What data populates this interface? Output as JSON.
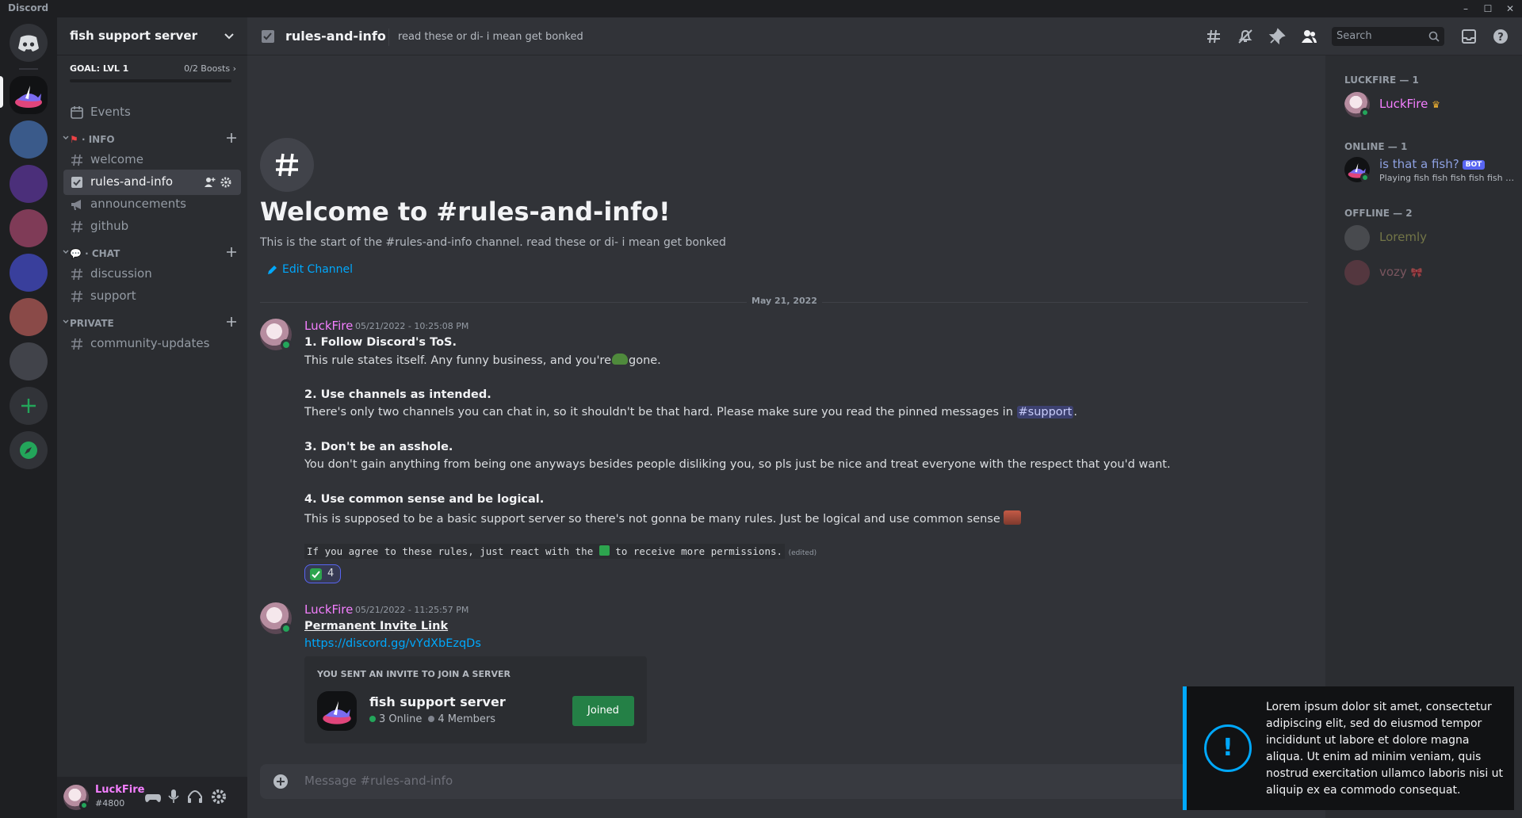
{
  "app": {
    "title": "Discord"
  },
  "server": {
    "name": "fish support server",
    "boost_goal": "GOAL: LVL 1",
    "boost_count": "0/2 Boosts",
    "boost_progress": 0
  },
  "sidebar": {
    "events": "Events",
    "categories": [
      {
        "name": "· INFO",
        "channels": [
          "welcome",
          "rules-and-info",
          "announcements",
          "github"
        ]
      },
      {
        "name": "· CHAT",
        "channels": [
          "discussion",
          "support"
        ]
      },
      {
        "name": "PRIVATE",
        "channels": [
          "community-updates"
        ]
      }
    ],
    "active_channel": "rules-and-info"
  },
  "user": {
    "name": "LuckFire",
    "tag": "#4800"
  },
  "channel": {
    "name": "rules-and-info",
    "topic": "read these or di- i mean get bonked",
    "search_placeholder": "Search"
  },
  "welcome": {
    "title": "Welcome to #rules-and-info!",
    "subtitle": "This is the start of the #rules-and-info channel. read these or di- i mean get bonked",
    "edit_label": "Edit Channel"
  },
  "date_separator": "May 21, 2022",
  "messages": [
    {
      "author": "LuckFire",
      "timestamp": "05/21/2022 - 10:25:08 PM",
      "rules": [
        {
          "title": "1. Follow Discord's ToS.",
          "body_a": "This rule states itself. Any funny business, and you're",
          "body_b": "gone."
        },
        {
          "title": "2. Use channels as intended.",
          "body_a": "There's only two channels you can chat in, so it shouldn't be that hard. Please make sure you read the pinned messages in",
          "mention": "#support",
          "body_b": "."
        },
        {
          "title": "3. Don't be an asshole.",
          "body_a": "You don't gain anything from being one anyways besides people disliking you, so pls just be nice and treat everyone with the respect that you'd want."
        },
        {
          "title": "4. Use common sense and be logical.",
          "body_a": "This is supposed to be a basic support server so there's not gonna be many rules. Just be logical and use common sense"
        }
      ],
      "code_a": "If you agree to these rules, just react with the",
      "code_b": "to receive more permissions.",
      "edited": "(edited)",
      "reaction_count": "4"
    },
    {
      "author": "LuckFire",
      "timestamp": "05/21/2022 - 11:25:57 PM",
      "title": "Permanent Invite Link",
      "link": "https://discord.gg/vYdXbEzqDs",
      "invite": {
        "header": "YOU SENT AN INVITE TO JOIN A SERVER",
        "server": "fish support server",
        "online": "3 Online",
        "members": "4 Members",
        "button": "Joined"
      }
    }
  ],
  "composer": {
    "placeholder": "Message #rules-and-info"
  },
  "members": {
    "groups": [
      {
        "label": "LUCKFIRE — 1",
        "members": [
          {
            "name": "LuckFire",
            "color": "#f47fff"
          }
        ]
      },
      {
        "label": "ONLINE — 1",
        "members": [
          {
            "name": "is that a fish?",
            "badge": "BOT",
            "activity": "Playing fish fish fish fish fish fi...",
            "color": "#8ea1e1"
          }
        ]
      },
      {
        "label": "OFFLINE — 2",
        "members": [
          {
            "name": "Loremly",
            "color": "#b9bc5e"
          },
          {
            "name": "vozy",
            "color": "#c77d8c"
          }
        ]
      }
    ]
  },
  "toast": {
    "message": "Lorem ipsum dolor sit amet, consectetur adipiscing elit, sed do eiusmod tempor incididunt ut labore et dolore magna aliqua. Ut enim ad minim veniam, quis nostrud exercitation ullamco laboris nisi ut aliquip ex ea commodo consequat.",
    "accent": "#00a8fc"
  },
  "colors": {
    "brand": "#5865f2",
    "author": "#f47fff",
    "online": "#23a55a",
    "join": "#248046"
  }
}
